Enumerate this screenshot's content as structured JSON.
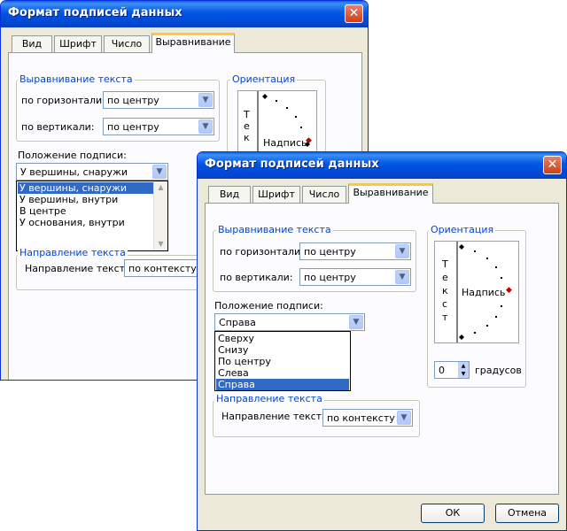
{
  "back_dialog": {
    "title": "Формат подписей данных",
    "close_glyph": "✕",
    "tabs": [
      "Вид",
      "Шрифт",
      "Число",
      "Выравнивание"
    ],
    "alignment_legend": "Выравнивание текста",
    "horizontal_label": "по горизонтали:",
    "horizontal_value": "по центру",
    "vertical_label": "по вертикали:",
    "vertical_value": "по центру",
    "orientation_legend": "Ориентация",
    "vertical_text": "Т е к",
    "orientation_word": "Надпись",
    "position_label": "Положение подписи:",
    "position_value": "У вершины, снаружи",
    "position_options": [
      "У вершины, снаружи",
      "У вершины, внутри",
      "В центре",
      "У основания, внутри"
    ],
    "direction_legend": "Направление текста",
    "direction_label": "Направление текста",
    "direction_value": "по контексту"
  },
  "front_dialog": {
    "title": "Формат подписей данных",
    "close_glyph": "✕",
    "tabs": [
      "Вид",
      "Шрифт",
      "Число",
      "Выравнивание"
    ],
    "alignment_legend": "Выравнивание текста",
    "horizontal_label": "по горизонтали:",
    "horizontal_value": "по центру",
    "vertical_label": "по вертикали:",
    "vertical_value": "по центру",
    "orientation_legend": "Ориентация",
    "vertical_text": "Т е к с т",
    "orientation_word": "Надпись",
    "degrees_value": "0",
    "degrees_label": "градусов",
    "position_label": "Положение подписи:",
    "position_value": "Справа",
    "position_options": [
      "Сверху",
      "Снизу",
      "По центру",
      "Слева",
      "Справа"
    ],
    "direction_legend": "Направление текста",
    "direction_label": "Направление текста",
    "direction_value": "по контексту",
    "ok_label": "ОК",
    "cancel_label": "Отмена"
  }
}
